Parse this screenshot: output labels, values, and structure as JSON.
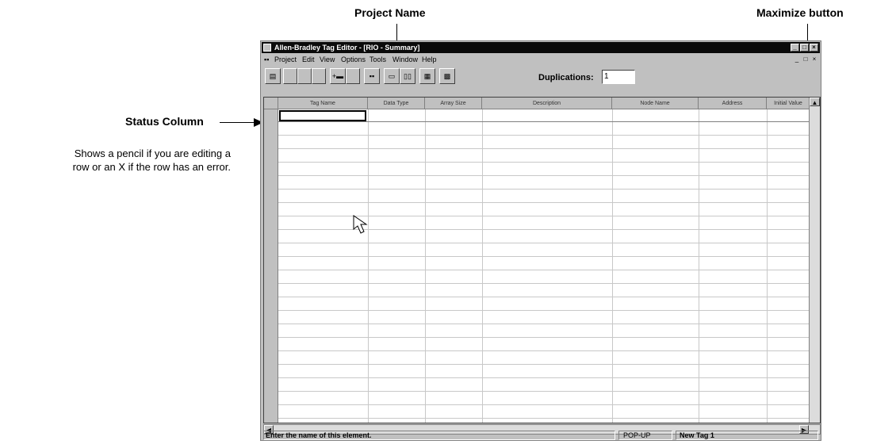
{
  "callouts": {
    "project_name": "Project Name",
    "maximize_button": "Maximize button",
    "status_column": "Status Column",
    "status_description_line1": "Shows a pencil if you are editing a",
    "status_description_line2": "row or an X if the row has an error."
  },
  "window": {
    "title": "Allen-Bradley Tag Editor - [RIO - Summary]",
    "title_buttons": [
      "_",
      "□",
      "×"
    ],
    "mdi_buttons": [
      "_",
      "□",
      "×"
    ]
  },
  "menu": [
    "Project",
    "Edit",
    "View",
    "Options",
    "Tools",
    "Window",
    "Help"
  ],
  "toolbar": {
    "duplications_label": "Duplications:",
    "duplications_value": "1"
  },
  "grid": {
    "columns": [
      "Tag Name",
      "Data Type",
      "Array Size",
      "Description",
      "Node Name",
      "Address",
      "Initial Value"
    ]
  },
  "statusbar": {
    "message": "Enter the name of this element.",
    "mode": "POP-UP",
    "tag": "New Tag 1"
  }
}
